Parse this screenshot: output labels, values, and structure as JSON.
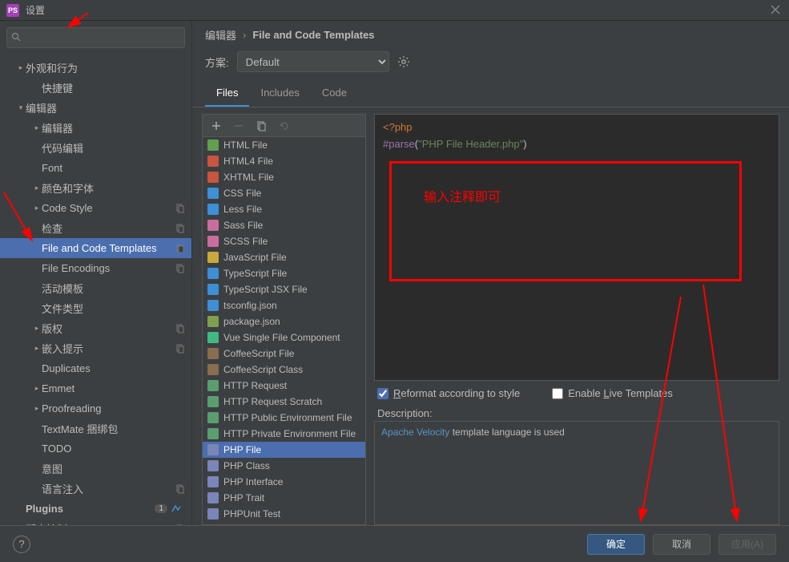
{
  "window": {
    "title": "设置"
  },
  "search": {
    "placeholder": ""
  },
  "sidebar": {
    "items": [
      {
        "label": "外观和行为",
        "level": 0,
        "arrow": ">",
        "copy": false
      },
      {
        "label": "快捷键",
        "level": 1,
        "arrow": "",
        "copy": false
      },
      {
        "label": "编辑器",
        "level": 0,
        "arrow": "v",
        "copy": false
      },
      {
        "label": "编辑器",
        "level": 1,
        "arrow": ">",
        "copy": false
      },
      {
        "label": "代码编辑",
        "level": 1,
        "arrow": "",
        "copy": false
      },
      {
        "label": "Font",
        "level": 1,
        "arrow": "",
        "copy": false
      },
      {
        "label": "颜色和字体",
        "level": 1,
        "arrow": ">",
        "copy": false
      },
      {
        "label": "Code Style",
        "level": 1,
        "arrow": ">",
        "copy": true
      },
      {
        "label": "检查",
        "level": 1,
        "arrow": "",
        "copy": true
      },
      {
        "label": "File and Code Templates",
        "level": 1,
        "arrow": "",
        "copy": true,
        "selected": true
      },
      {
        "label": "File Encodings",
        "level": 1,
        "arrow": "",
        "copy": true
      },
      {
        "label": "活动模板",
        "level": 1,
        "arrow": "",
        "copy": false
      },
      {
        "label": "文件类型",
        "level": 1,
        "arrow": "",
        "copy": false
      },
      {
        "label": "版权",
        "level": 1,
        "arrow": ">",
        "copy": true
      },
      {
        "label": "嵌入提示",
        "level": 1,
        "arrow": ">",
        "copy": true
      },
      {
        "label": "Duplicates",
        "level": 1,
        "arrow": "",
        "copy": false
      },
      {
        "label": "Emmet",
        "level": 1,
        "arrow": ">",
        "copy": false
      },
      {
        "label": "Proofreading",
        "level": 1,
        "arrow": ">",
        "copy": false
      },
      {
        "label": "TextMate 捆绑包",
        "level": 1,
        "arrow": "",
        "copy": false
      },
      {
        "label": "TODO",
        "level": 1,
        "arrow": "",
        "copy": false
      },
      {
        "label": "意图",
        "level": 1,
        "arrow": "",
        "copy": false
      },
      {
        "label": "语言注入",
        "level": 1,
        "arrow": "",
        "copy": true
      },
      {
        "label": "Plugins",
        "level": 0,
        "arrow": "",
        "copy": false,
        "bold": true,
        "badge": "1",
        "globe": true
      },
      {
        "label": "版本控制",
        "level": 0,
        "arrow": ">",
        "copy": true
      }
    ]
  },
  "breadcrumb": {
    "root": "编辑器",
    "current": "File and Code Templates"
  },
  "scheme": {
    "label": "方案:",
    "value": "Default"
  },
  "tabs": [
    {
      "label": "Files",
      "active": true
    },
    {
      "label": "Includes",
      "active": false
    },
    {
      "label": "Code",
      "active": false
    }
  ],
  "files": [
    {
      "label": "HTML File",
      "color": "#61a04f"
    },
    {
      "label": "HTML4 File",
      "color": "#c9553e"
    },
    {
      "label": "XHTML File",
      "color": "#c9553e"
    },
    {
      "label": "CSS File",
      "color": "#3d8fd6"
    },
    {
      "label": "Less File",
      "color": "#3d8fd6"
    },
    {
      "label": "Sass File",
      "color": "#c96d9e"
    },
    {
      "label": "SCSS File",
      "color": "#c96d9e"
    },
    {
      "label": "JavaScript File",
      "color": "#c9a83e"
    },
    {
      "label": "TypeScript File",
      "color": "#3d8fd6"
    },
    {
      "label": "TypeScript JSX File",
      "color": "#3d8fd6"
    },
    {
      "label": "tsconfig.json",
      "color": "#3d8fd6"
    },
    {
      "label": "package.json",
      "color": "#7ea04f"
    },
    {
      "label": "Vue Single File Component",
      "color": "#41b883"
    },
    {
      "label": "CoffeeScript File",
      "color": "#8a6d4f"
    },
    {
      "label": "CoffeeScript Class",
      "color": "#8a6d4f"
    },
    {
      "label": "HTTP Request",
      "color": "#5a9e6f"
    },
    {
      "label": "HTTP Request Scratch",
      "color": "#5a9e6f"
    },
    {
      "label": "HTTP Public Environment File",
      "color": "#5a9e6f"
    },
    {
      "label": "HTTP Private Environment File",
      "color": "#5a9e6f"
    },
    {
      "label": "PHP File",
      "color": "#7a86b8",
      "selected": true
    },
    {
      "label": "PHP Class",
      "color": "#7a86b8"
    },
    {
      "label": "PHP Interface",
      "color": "#7a86b8"
    },
    {
      "label": "PHP Trait",
      "color": "#7a86b8"
    },
    {
      "label": "PHPUnit Test",
      "color": "#7a86b8"
    }
  ],
  "editor": {
    "line1_open": "<?php",
    "line2_fn": "#parse",
    "line2_paren_open": "(",
    "line2_str": "\"PHP File Header.php\"",
    "line2_paren_close": ")"
  },
  "annotation": {
    "text": "输入注释即可"
  },
  "options": {
    "reformat_pre": "R",
    "reformat_post": "eformat according to style",
    "reformat_checked": true,
    "live_pre": "Enable ",
    "live_u": "L",
    "live_post": "ive Templates",
    "live_checked": false
  },
  "description": {
    "label": "Description:",
    "link": "Apache Velocity",
    "rest": " template language is used"
  },
  "buttons": {
    "ok": "确定",
    "cancel": "取消",
    "apply": "应用(A)"
  }
}
